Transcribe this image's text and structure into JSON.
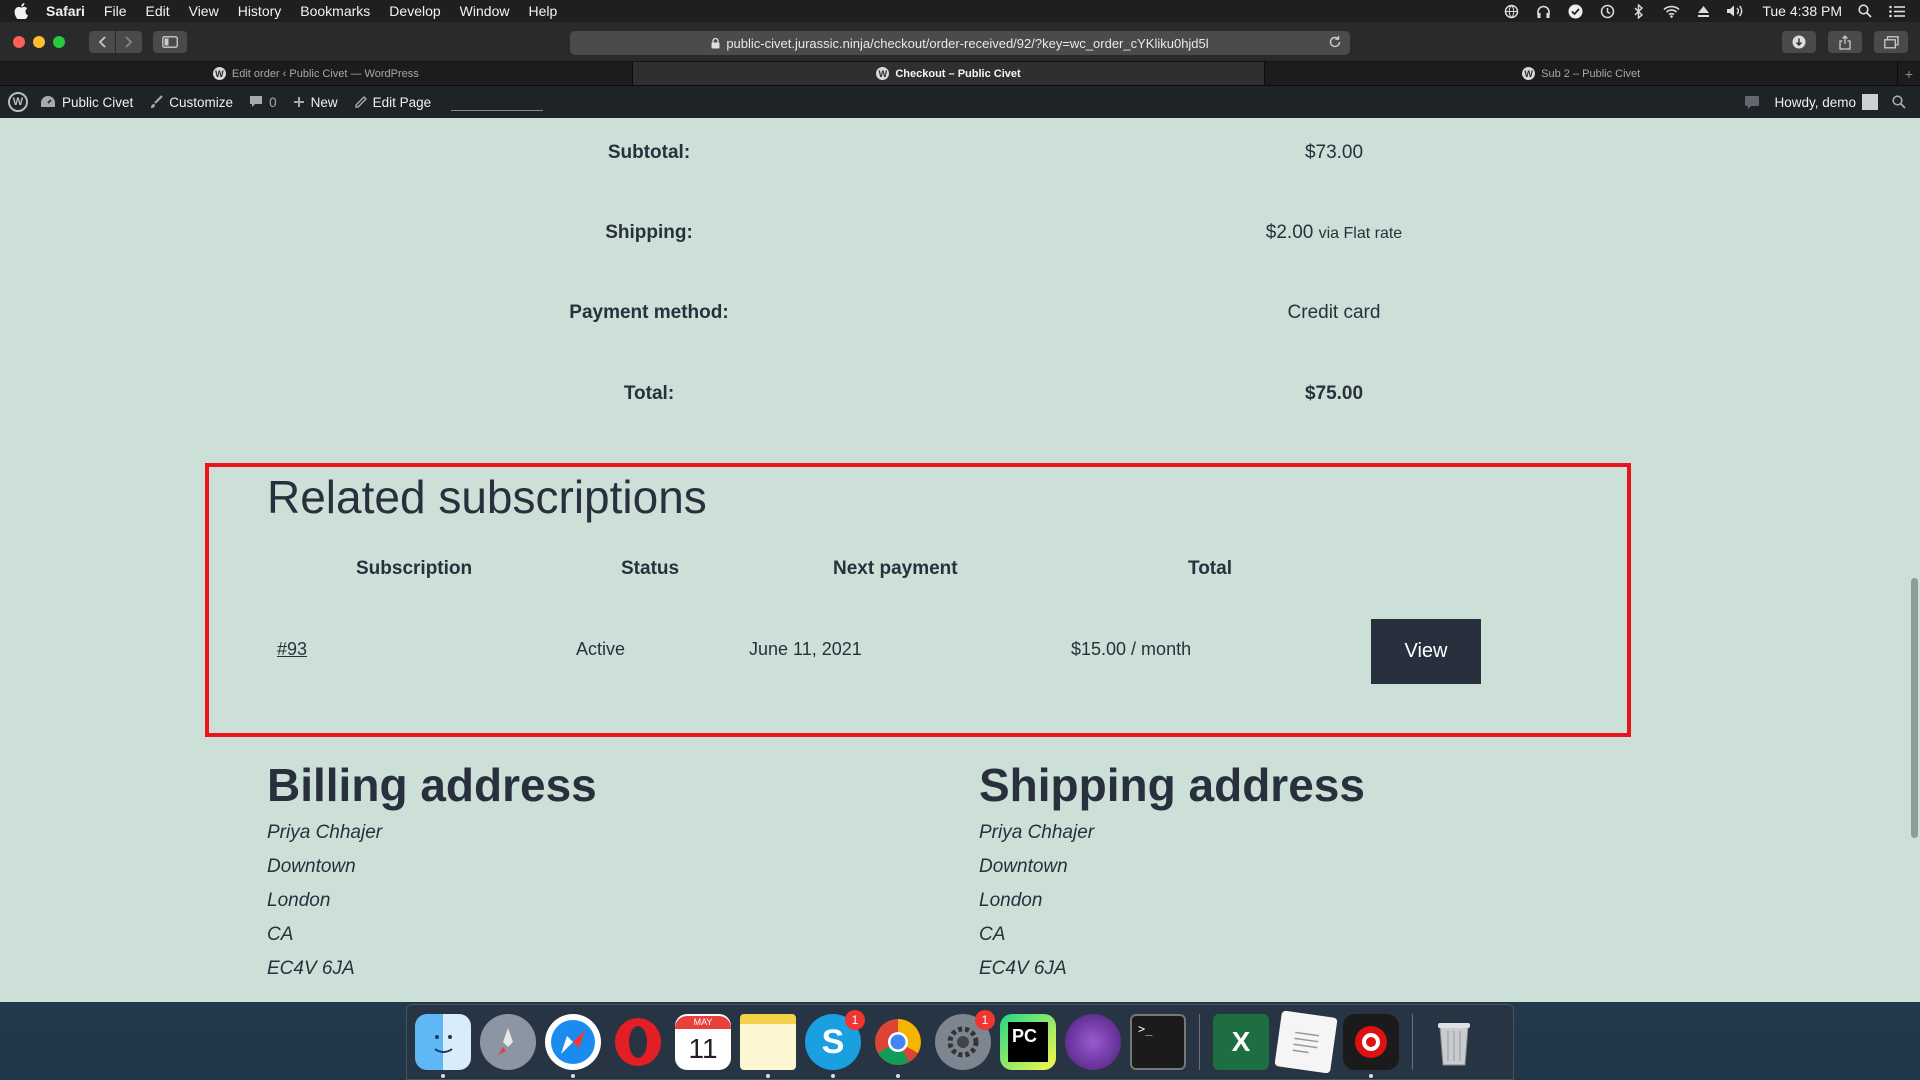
{
  "menubar": {
    "app": "Safari",
    "items": [
      "File",
      "Edit",
      "View",
      "History",
      "Bookmarks",
      "Develop",
      "Window",
      "Help"
    ],
    "clock": "Tue 4:38 PM"
  },
  "browser": {
    "url": "public-civet.jurassic.ninja/checkout/order-received/92/?key=wc_order_cYKliku0hjd5l",
    "tabs": [
      {
        "title": "Edit order ‹ Public Civet — WordPress",
        "active": false
      },
      {
        "title": "Checkout – Public Civet",
        "active": true
      },
      {
        "title": "Sub 2 – Public Civet",
        "active": false
      }
    ]
  },
  "adminbar": {
    "site": "Public Civet",
    "customize": "Customize",
    "comments": "0",
    "new": "New",
    "edit_page": "Edit Page",
    "howdy": "Howdy, demo"
  },
  "order_totals": [
    {
      "label": "Subtotal:",
      "value": "$73.00",
      "note": ""
    },
    {
      "label": "Shipping:",
      "value": "$2.00",
      "note": "via Flat rate"
    },
    {
      "label": "Payment method:",
      "value": "Credit card",
      "note": ""
    },
    {
      "label": "Total:",
      "value": "$75.00",
      "note": ""
    }
  ],
  "related": {
    "title": "Related subscriptions",
    "headers": [
      "Subscription",
      "Status",
      "Next payment",
      "Total"
    ],
    "row": {
      "subscription": "#93",
      "status": "Active",
      "next_payment": "June 11, 2021",
      "total": "$15.00 / month",
      "action": "View"
    }
  },
  "billing": {
    "title": "Billing address",
    "lines": [
      "Priya Chhajer",
      "Downtown",
      "London",
      "CA",
      "EC4V 6JA"
    ]
  },
  "shipping": {
    "title": "Shipping address",
    "lines": [
      "Priya Chhajer",
      "Downtown",
      "London",
      "CA",
      "EC4V 6JA"
    ]
  },
  "dock": {
    "apps": [
      "finder-icon",
      "launchpad-icon",
      "safari-icon",
      "opera-icon",
      "calendar-icon",
      "notes-icon",
      "skype-icon",
      "chrome-icon",
      "system-preferences-icon",
      "pycharm-icon",
      "tor-icon",
      "terminal-icon",
      "excel-icon",
      "textedit-icon",
      "photo-booth-icon",
      "trash-icon"
    ],
    "calendar_month": "MAY",
    "calendar_day": "11",
    "skype_badge": "1",
    "prefs_badge": "1"
  },
  "colors": {
    "page_bg": "#cce0d8",
    "text": "#28303d",
    "highlight_border": "#e8141a",
    "button_bg": "#28303d"
  }
}
